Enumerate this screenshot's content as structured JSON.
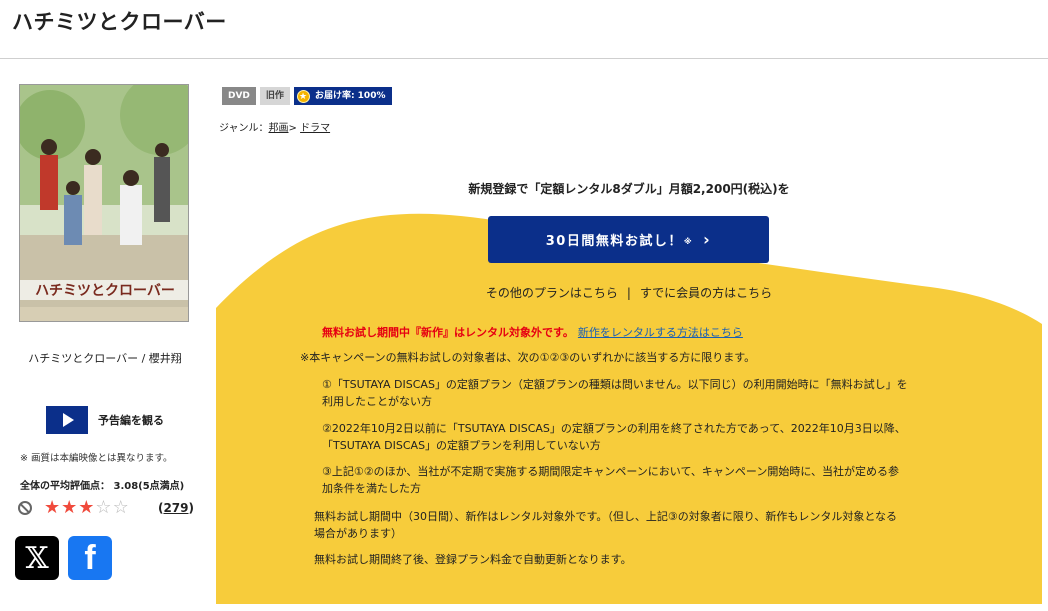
{
  "page": {
    "title": "ハチミツとクローバー"
  },
  "product": {
    "name": "ハチミツとクローバー / 櫻井翔"
  },
  "trailer": {
    "label": "予告編を観る"
  },
  "note": "※ 画質は本編映像とは異なります。",
  "rating": {
    "average_text": "全体の平均評価点： 3.08(5点満点)",
    "stars_filled": 3,
    "stars_total": 5,
    "review_count": "279",
    "review_open": "(",
    "review_close": ")"
  },
  "social": {
    "x_label": "𝕏",
    "facebook_label": "f"
  },
  "badges": {
    "dvd": "DVD",
    "old": "旧作",
    "delivery": "お届け率: 100%"
  },
  "genre": {
    "label": "ジャンル：",
    "parent": "邦画",
    "arrow": ">",
    "child": "ドラマ"
  },
  "promo": {
    "headline": "新規登録で「定額レンタル8ダブル」月額2,200円(税込)を",
    "cta_label": "30日間無料お試し！",
    "cta_note": "※",
    "cta_chevron": "›",
    "other_plans": "その他のプランはこちら",
    "separator": "|",
    "member": "すでに会員の方はこちら",
    "warning_red": "無料お試し期間中『新作』はレンタル対象外です。",
    "warning_link": "新作をレンタルする方法はこちら"
  },
  "terms": {
    "intro": "※本キャンペーンの無料お試しの対象者は、次の①②③のいずれかに該当する方に限ります。",
    "item1_line1": "①「TSUTAYA DISCAS」の定額プラン（定額プランの種類は問いません。以下同じ）の利用開始時に「無料お試し」を",
    "item1_line2": "利用したことがない方",
    "item2_line1": "②2022年10月2日以前に「TSUTAYA DISCAS」の定額プランの利用を終了された方であって、2022年10月3日以降、",
    "item2_line2": "「TSUTAYA DISCAS」の定額プランを利用していない方",
    "item3_line1": "③上記①②のほか、当社が不定期で実施する期間限定キャンペーンにおいて、キャンペーン開始時に、当社が定める参",
    "item3_line2": "加条件を満たした方",
    "trial_line1": "無料お試し期間中（30日間）、新作はレンタル対象外です。（但し、上記③の対象者に限り、新作もレンタル対象となる",
    "trial_line2": "場合があります）",
    "renewal": "無料お試し期間終了後、登録プラン料金で自動更新となります。"
  },
  "colors": {
    "accent_blue": "#0b2f8a",
    "promo_yellow": "#f7cc3b",
    "warning_red": "#e60012",
    "link_blue": "#1a5fb4",
    "star_red": "#f04a3c"
  }
}
